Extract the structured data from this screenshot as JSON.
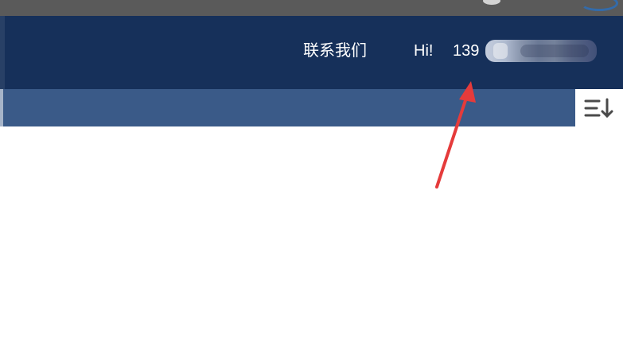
{
  "header": {
    "contact_label": "联系我们",
    "greeting": "Hi!",
    "phone_visible_prefix": "139",
    "phone_masked_icon": "blurred-phone-number"
  },
  "toolbar": {
    "sort_icon": "sort-descending-icon"
  },
  "colors": {
    "topbar": "#5a5a5a",
    "header": "#16305a",
    "subbar": "#3a5a88",
    "annotation_arrow": "#e53b3b"
  }
}
